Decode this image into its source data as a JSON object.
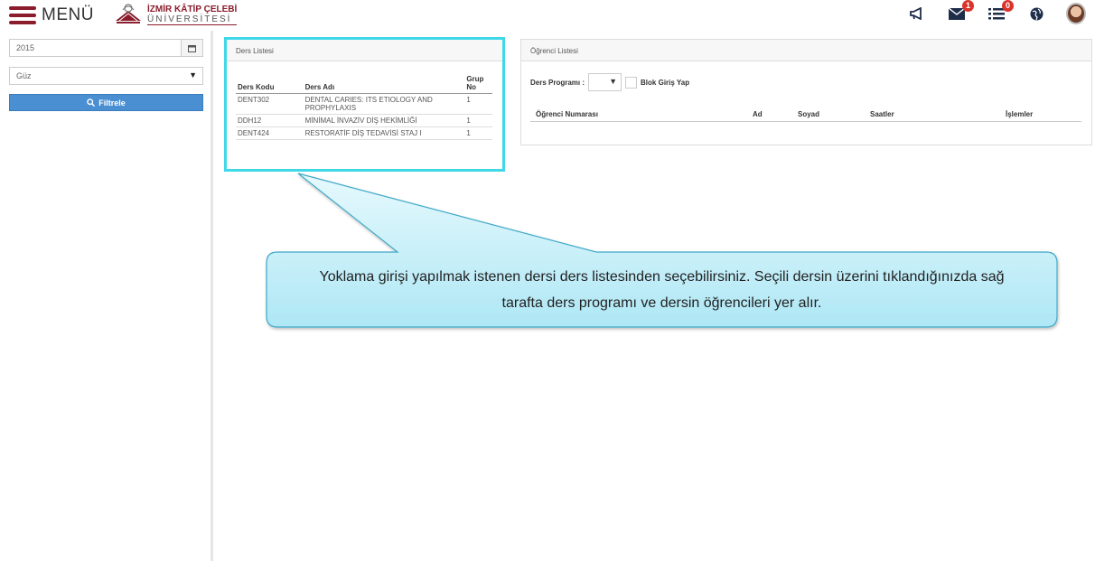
{
  "header": {
    "menu_label": "MENÜ",
    "logo_line1": "İZMİR KÂTİP ÇELEBİ",
    "logo_line2": "ÜNİVERSİTESİ",
    "icons": [
      "megaphone-icon",
      "mail-icon",
      "list-icon",
      "globe-icon",
      "avatar"
    ],
    "mail_badge": "1",
    "list_badge": "0"
  },
  "sidebar": {
    "year_value": "2015",
    "term_value": "Güz",
    "filter_label": "Filtrele"
  },
  "ders_listesi": {
    "title": "Ders Listesi",
    "columns": [
      "Ders Kodu",
      "Ders Adı",
      "Grup No"
    ],
    "rows": [
      {
        "code": "DENT302",
        "name": "DENTAL CARIES: ITS ETIOLOGY AND PROPHYLAXIS",
        "group": "1"
      },
      {
        "code": "DDH12",
        "name": "MİNİMAL İNVAZİV DİŞ HEKİMLİĞİ",
        "group": "1"
      },
      {
        "code": "DENT424",
        "name": "RESTORATİF DİŞ TEDAVİSİ STAJ I",
        "group": "1"
      }
    ]
  },
  "ogrenci_listesi": {
    "title": "Öğrenci Listesi",
    "program_label": "Ders Programı :",
    "program_value": "",
    "block_entry_label": "Blok Giriş Yap",
    "columns": [
      "Öğrenci Numarası",
      "Ad",
      "Soyad",
      "Saatler",
      "İşlemler"
    ]
  },
  "callout": {
    "text": "Yoklama girişi yapılmak istenen dersi ders listesinden seçebilirsiniz. Seçili dersin üzerini tıklandığınızda sağ tarafta ders programı ve dersin öğrencileri yer alır."
  },
  "colors": {
    "brand": "#8a1c2b",
    "highlight": "#3fd8e8",
    "primary_button": "#4a8fd2",
    "badge": "#d9342b"
  }
}
